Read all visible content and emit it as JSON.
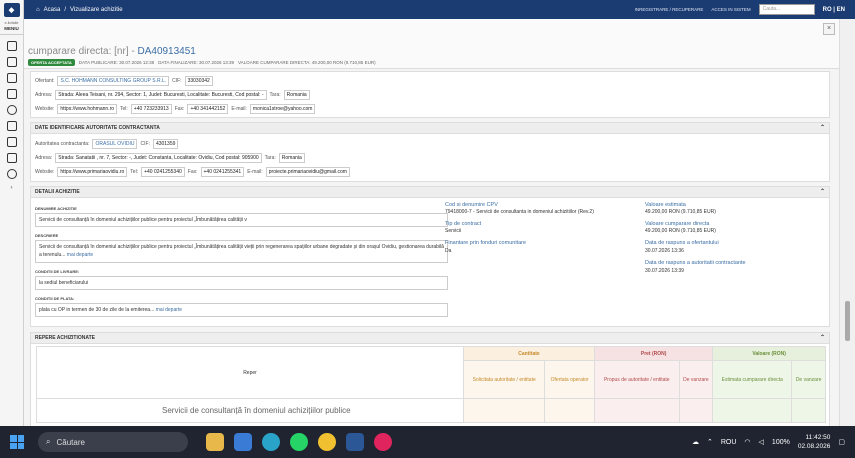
{
  "rail": {
    "sub": "e-licitatie",
    "menu": "MENIU"
  },
  "topbar": {
    "home": "Acasa",
    "sep": "/",
    "current": "Vizualizare achizitie",
    "link1": "INREGISTRARE / RECUPERARE",
    "link2": "ACCES IN SISTEM",
    "search_placeholder": "Cauta...",
    "lang": "RO | EN"
  },
  "header": {
    "close": "×",
    "title_prefix": "cumparare directa: [nr] - ",
    "title_code": "DA40913451",
    "badge": "OFERTA ACCEPTATA",
    "pub": "DATA PUBLICARE: 30.07.2026 12:38",
    "fin": "DATA FINALIZARE: 30.07.2026 13:39",
    "val": "VALOARE CUMPARARE DIRECTA: 49.200,00 RON (9.710,85 EUR)"
  },
  "ofertant": {
    "label": "Ofertant:",
    "name": "S.C. HOHMANN CONSULTING GROUP S.R.L.",
    "cif_label": "CIF:",
    "cif": "33030342",
    "addr_label": "Adresa:",
    "addr": "Strada: Aleea Teisani, nr. 294, Sector: 1, Judet: Bucuresti, Localitate: Bucuresti, Cod postal: -",
    "tara_label": "Tara:",
    "tara": "Romania",
    "web_label": "Website:",
    "web": "https://www.hohmann.ro",
    "tel_label": "Tel:",
    "tel": "+40 723233913",
    "fax_label": "Fax:",
    "fax": "+40 341442152",
    "email_label": "E-mail:",
    "email": "monica1stroe@yahoo.com"
  },
  "autoritate": {
    "section": "DATE IDENTIFICARE AUTORITATE CONTRACTANTA",
    "label": "Autoritatea contractanta:",
    "name": "ORASUL OVIDIU",
    "cif_label": "CIF:",
    "cif": "4301359",
    "addr_label": "Adresa:",
    "addr": "Strada: Sanatatii , nr. 7, Sector: -, Judet: Constanta, Localitate: Ovidiu, Cod postal: 905900",
    "tara_label": "Tara:",
    "tara": "Romania",
    "web_label": "Website:",
    "web": "https://www.primariaovidiu.ro",
    "tel_label": "Tel:",
    "tel": "+40 0241255340",
    "fax_label": "Fax:",
    "fax": "+40 0241255341",
    "email_label": "E-mail:",
    "email": "proiecte.primariaovidiu@gmail.com"
  },
  "detalii": {
    "section": "DETALII ACHIZITIE",
    "den_label": "DENUMIRE ACHIZITIE",
    "den": "Servicii de consultanță în domeniul achizițiilor publice pentru proiectul „Îmbunătățirea calității v",
    "desc_label": "DESCRIERE",
    "desc": "Servicii de consultanță în domeniul achizițiilor publice pentru proiectul „Îmbunătățirea calității vieții prin regenerarea spațiilor urbane degradate și din orașul Ovidiu, gestionarea durabilă a terenulu...",
    "more": "mai departe",
    "livr_label": "CONDITII DE LIVRARE:",
    "livr": "la sediul beneficiarului",
    "plata_label": "CONDITII DE PLATA:",
    "plata": "plata cu OP in termen de 30 de zile de la emiterea...",
    "cpv_label": "Cod si denumire CPV",
    "cpv": "79418000-7 - Servicii de consultanta in domeniul achizitiilor (Rev.2)",
    "tip_label": "Tip de contract",
    "tip": "Servicii",
    "fin_label": "Finantare prin fonduri comunitare",
    "fin": "Da",
    "est_label": "Valoare estimata",
    "est": "49.200,00  RON (9.710,85  EUR)",
    "vcd_label": "Valoare cumparare directa",
    "vcd": "49.200,00  RON (9.710,85  EUR)",
    "dro_label": "Data de raspuns a ofertantului",
    "dro": "30.07.2026 13:36",
    "drac_label": "Data de raspuns a autoritatii contractante",
    "drac": "30.07.2026 13:39"
  },
  "repere": {
    "section": "REPERE ACHIZITIONATE",
    "reper": "Reper",
    "cantitate": "Cantitate",
    "pret": "Pret (RON)",
    "valoare": "Valoare (RON)",
    "solicitata": "Solicitata autoritate / entitate",
    "oferta_op": "Ofertata operator",
    "propus": "Propus de autoritate / entitate",
    "vanzare": "De vanzare",
    "estimata": "Estimata cumparare directa",
    "vanzare2": "De vanzare",
    "row_text": "Servicii de consultanță în domeniul achizițiilor publice"
  },
  "taskbar": {
    "search": "Căutare",
    "lang": "ROU",
    "battery": "100%",
    "time": "11:42:50",
    "date": "02.08.2026"
  }
}
